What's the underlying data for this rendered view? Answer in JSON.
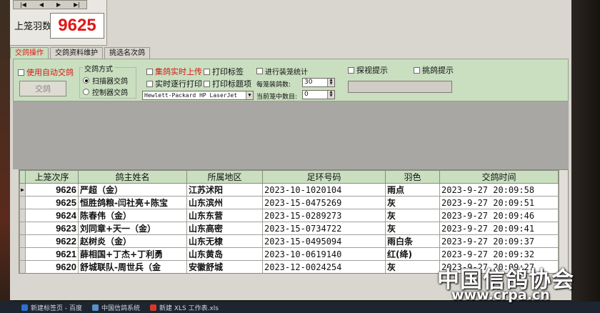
{
  "nav_buttons": [
    "|◀",
    "◀",
    "▶",
    "▶|"
  ],
  "counter": {
    "label": "上笼羽数:",
    "value": "9625"
  },
  "tabs": [
    {
      "label": "交鸽操作",
      "active": true
    },
    {
      "label": "交鸽资料维护",
      "active": false
    },
    {
      "label": "挑选名次鸽",
      "active": false
    }
  ],
  "controls": {
    "auto_release": "使用自动交鸽",
    "release_button": "交鸽",
    "mode_title": "交鸽方式",
    "mode_scanner": "扫描器交鸽",
    "mode_controller": "控制器交鸽",
    "realtime_upload": "集鸽实时上传",
    "print_label": "打印标签",
    "realtime_print": "实时逐行打印",
    "print_header": "打印标题项",
    "printer": "Hewlett-Packard HP LaserJet",
    "cage_stats": "进行装笼统计",
    "per_cage_label": "每笼装鸽数:",
    "per_cage_value": "30",
    "current_count_label": "当前笼中数目:",
    "current_count_value": "0",
    "watch_hint": "探视提示",
    "pick_hint": "挑鸽提示"
  },
  "table": {
    "columns": [
      "上笼次序",
      "鸽主姓名",
      "所属地区",
      "足环号码",
      "羽色",
      "交鸽时间"
    ],
    "rows": [
      [
        "9626",
        "严超（金）",
        "江苏沭阳",
        "2023-10-1020104",
        "雨点",
        "2023-9-27  20:09:58"
      ],
      [
        "9625",
        "恒胜鸽粮-闫社亮+陈宝",
        "山东滨州",
        "2023-15-0475269",
        "灰",
        "2023-9-27  20:09:51"
      ],
      [
        "9624",
        "陈春伟（金）",
        "山东东营",
        "2023-15-0289273",
        "灰",
        "2023-9-27  20:09:46"
      ],
      [
        "9623",
        "刘同章+天一（金）",
        "山东高密",
        "2023-15-0734722",
        "灰",
        "2023-9-27  20:09:41"
      ],
      [
        "9622",
        "赵树炎（金）",
        "山东无棣",
        "2023-15-0495094",
        "雨白条",
        "2023-9-27  20:09:37"
      ],
      [
        "9621",
        "薛相国+丁杰+丁利勇",
        "山东黄岛",
        "2023-10-0619140",
        "红(绛)",
        "2023-9-27  20:09:32"
      ],
      [
        "9620",
        "舒城联队-周世兵（金",
        "安徽舒城",
        "2023-12-0024254",
        "灰",
        "2023-9-27  20:09:27"
      ]
    ]
  },
  "taskbar": [
    "新建标签页 - 百度",
    "中国信鸽系统",
    "新建 XLS 工作表.xls"
  ],
  "watermark": {
    "line1": "中国信鸽协会",
    "line2": "www.crpa.cn"
  },
  "colors": {
    "accent_red": "#e01717",
    "panel_green": "#c9dfc0"
  }
}
